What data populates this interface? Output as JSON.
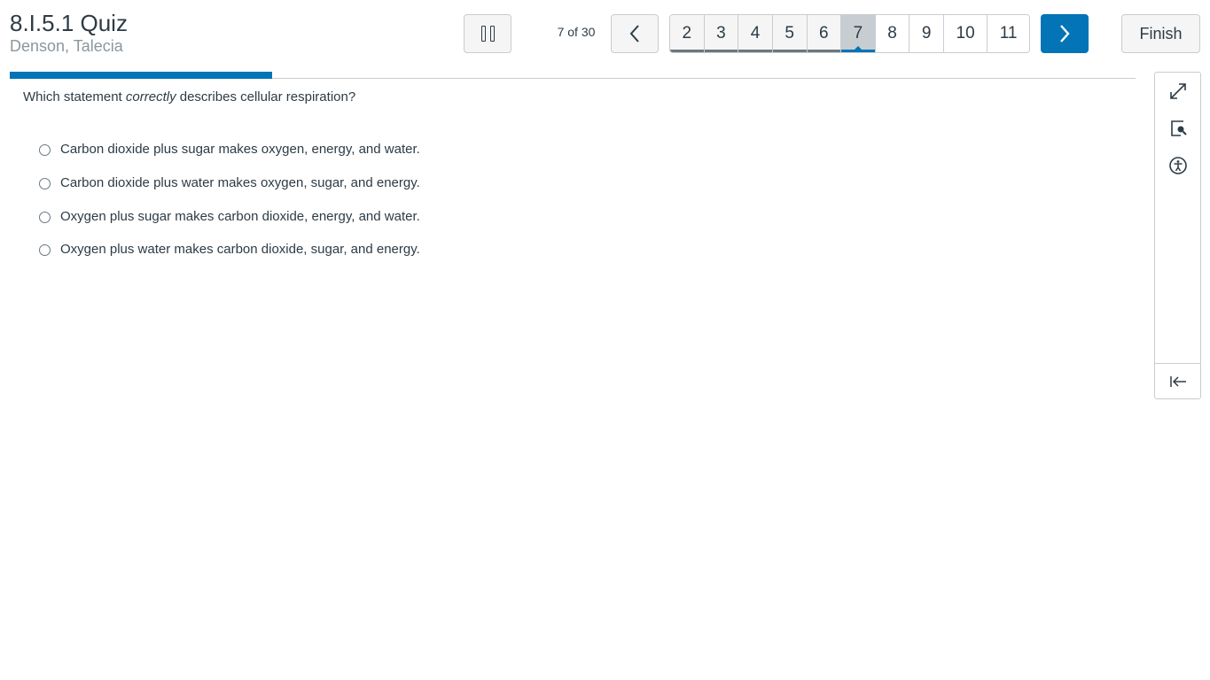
{
  "header": {
    "quiz_title": "8.I.5.1 Quiz",
    "student_name": "Denson, Talecia"
  },
  "toolbar": {
    "progress_text": "7 of 30",
    "finish_label": "Finish",
    "pause_icon": "pause-icon",
    "prev_icon": "chevron-left-icon",
    "next_icon": "chevron-right-icon"
  },
  "question_nav": {
    "items": [
      {
        "label": "2",
        "state": "answered"
      },
      {
        "label": "3",
        "state": "answered"
      },
      {
        "label": "4",
        "state": "answered"
      },
      {
        "label": "5",
        "state": "answered"
      },
      {
        "label": "6",
        "state": "answered"
      },
      {
        "label": "7",
        "state": "current"
      },
      {
        "label": "8",
        "state": "unanswered"
      },
      {
        "label": "9",
        "state": "unanswered"
      },
      {
        "label": "10",
        "state": "unanswered"
      },
      {
        "label": "11",
        "state": "unanswered"
      }
    ]
  },
  "progress": {
    "fraction": 0.233
  },
  "question": {
    "prefix": "Which statement ",
    "emphasis": "correctly",
    "suffix": " describes cellular respiration?",
    "choices": [
      "Carbon dioxide plus sugar makes oxygen, energy, and water.",
      "Carbon dioxide plus water makes oxygen, sugar, and energy.",
      "Oxygen plus sugar makes carbon dioxide, energy, and water.",
      "Oxygen plus water makes carbon dioxide, sugar, and energy."
    ]
  },
  "side_tools": {
    "icons": [
      "expand-icon",
      "magnifier-icon",
      "accessibility-icon",
      "collapse-panel-icon"
    ]
  },
  "colors": {
    "accent": "#0374b5",
    "text": "#2d3b45",
    "muted": "#8b969e",
    "border": "#c7cdd1"
  }
}
